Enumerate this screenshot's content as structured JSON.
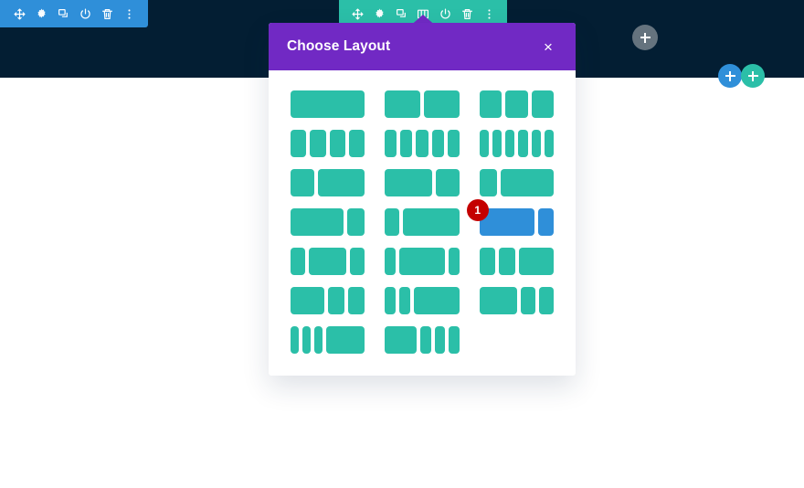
{
  "page": {
    "header_band_color": "#031e33",
    "background_color": "#ffffff"
  },
  "toolbars": {
    "left": {
      "background": "#2f8fd9",
      "icons": [
        {
          "name": "move-icon",
          "label": "Move"
        },
        {
          "name": "gear-icon",
          "label": "Settings"
        },
        {
          "name": "duplicate-icon",
          "label": "Duplicate"
        },
        {
          "name": "power-icon",
          "label": "Disable"
        },
        {
          "name": "trash-icon",
          "label": "Delete"
        },
        {
          "name": "more-options-icon",
          "label": "More Options"
        }
      ]
    },
    "center": {
      "background": "#2bbfa8",
      "icons": [
        {
          "name": "move-icon",
          "label": "Move"
        },
        {
          "name": "gear-icon",
          "label": "Settings"
        },
        {
          "name": "duplicate-icon",
          "label": "Duplicate"
        },
        {
          "name": "columns-icon",
          "label": "Change Column Structure"
        },
        {
          "name": "power-icon",
          "label": "Disable"
        },
        {
          "name": "trash-icon",
          "label": "Delete"
        },
        {
          "name": "more-options-icon",
          "label": "More Options"
        }
      ],
      "active_icon": "columns-icon",
      "pointer_color": "#7129c4"
    }
  },
  "floating_buttons": [
    {
      "name": "add-section-button",
      "glyph": "+",
      "color": "#65737e"
    },
    {
      "name": "add-row-blue-button",
      "glyph": "+",
      "color": "#2f8fd9"
    },
    {
      "name": "add-row-teal-button",
      "glyph": "+",
      "color": "#2bbfa8"
    }
  ],
  "modal": {
    "title": "Choose Layout",
    "close_label": "×",
    "header_color": "#7129c4",
    "body_color": "#ffffff",
    "block_color": "#2bbfa8",
    "selected_color": "#2f8fd9",
    "badge_color": "#c40000",
    "selected_badge": "1",
    "selected_index": 11,
    "layouts": [
      {
        "name": "layout-1-column",
        "columns": [
          100
        ]
      },
      {
        "name": "layout-2-columns-equal",
        "columns": [
          50,
          50
        ]
      },
      {
        "name": "layout-3-columns-equal",
        "columns": [
          33.33,
          33.33,
          33.33
        ]
      },
      {
        "name": "layout-4-columns-equal",
        "columns": [
          25,
          25,
          25,
          25
        ]
      },
      {
        "name": "layout-5-columns-equal",
        "columns": [
          20,
          20,
          20,
          20,
          20
        ]
      },
      {
        "name": "layout-6-columns-equal",
        "columns": [
          16.66,
          16.66,
          16.66,
          16.66,
          16.66,
          16.66
        ]
      },
      {
        "name": "layout-one-third-two-thirds",
        "columns": [
          33.33,
          66.66
        ]
      },
      {
        "name": "layout-two-thirds-one-third",
        "columns": [
          66.66,
          33.33
        ]
      },
      {
        "name": "layout-one-fourth-three-fourths",
        "columns": [
          25,
          75
        ]
      },
      {
        "name": "layout-three-fourths-one-fourth",
        "columns": [
          75,
          25
        ]
      },
      {
        "name": "layout-one-fourth-three-fourths-b",
        "columns": [
          20,
          80
        ]
      },
      {
        "name": "layout-three-fourths-one-fourth-selected",
        "columns": [
          78,
          22
        ]
      },
      {
        "name": "layout-fourth-half-fourth",
        "columns": [
          22,
          56,
          22
        ]
      },
      {
        "name": "layout-fifth-three-fifths-fifth",
        "columns": [
          16,
          68,
          16
        ]
      },
      {
        "name": "layout-fourth-fourth-half",
        "columns": [
          24,
          24,
          52
        ]
      },
      {
        "name": "layout-half-fourth-fourth",
        "columns": [
          50,
          25,
          25
        ]
      },
      {
        "name": "layout-fifth-fifth-three-fifths",
        "columns": [
          16,
          16,
          68
        ]
      },
      {
        "name": "layout-half-fourth-fourth-b",
        "columns": [
          56,
          22,
          22
        ]
      },
      {
        "name": "layout-sixth-sixth-sixth-half",
        "columns": [
          13,
          13,
          13,
          61
        ]
      },
      {
        "name": "layout-half-sixth-sixth-sixth",
        "columns": [
          45,
          15,
          15,
          15
        ]
      }
    ]
  }
}
